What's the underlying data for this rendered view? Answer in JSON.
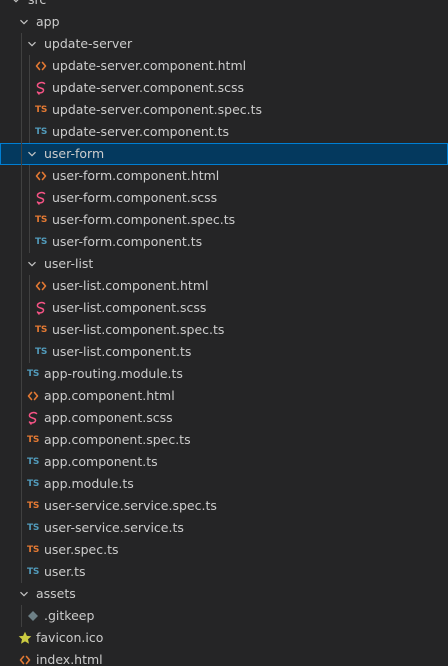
{
  "explorer": {
    "items": [
      {
        "label": "src",
        "kind": "folder",
        "depth": 0,
        "name": "folder-src"
      },
      {
        "label": "app",
        "kind": "folder",
        "depth": 1,
        "name": "folder-app"
      },
      {
        "label": "update-server",
        "kind": "folder",
        "depth": 2,
        "name": "folder-update-server"
      },
      {
        "label": "update-server.component.html",
        "kind": "html",
        "depth": 3,
        "name": "file-update-server-component-html"
      },
      {
        "label": "update-server.component.scss",
        "kind": "scss",
        "depth": 3,
        "name": "file-update-server-component-scss"
      },
      {
        "label": "update-server.component.spec.ts",
        "kind": "spec",
        "depth": 3,
        "name": "file-update-server-component-spec-ts"
      },
      {
        "label": "update-server.component.ts",
        "kind": "ts",
        "depth": 3,
        "name": "file-update-server-component-ts"
      },
      {
        "label": "user-form",
        "kind": "folder",
        "depth": 2,
        "selected": true,
        "name": "folder-user-form"
      },
      {
        "label": "user-form.component.html",
        "kind": "html",
        "depth": 3,
        "name": "file-user-form-component-html"
      },
      {
        "label": "user-form.component.scss",
        "kind": "scss",
        "depth": 3,
        "name": "file-user-form-component-scss"
      },
      {
        "label": "user-form.component.spec.ts",
        "kind": "spec",
        "depth": 3,
        "name": "file-user-form-component-spec-ts"
      },
      {
        "label": "user-form.component.ts",
        "kind": "ts",
        "depth": 3,
        "name": "file-user-form-component-ts"
      },
      {
        "label": "user-list",
        "kind": "folder",
        "depth": 2,
        "name": "folder-user-list"
      },
      {
        "label": "user-list.component.html",
        "kind": "html",
        "depth": 3,
        "name": "file-user-list-component-html"
      },
      {
        "label": "user-list.component.scss",
        "kind": "scss",
        "depth": 3,
        "name": "file-user-list-component-scss"
      },
      {
        "label": "user-list.component.spec.ts",
        "kind": "spec",
        "depth": 3,
        "name": "file-user-list-component-spec-ts"
      },
      {
        "label": "user-list.component.ts",
        "kind": "ts",
        "depth": 3,
        "name": "file-user-list-component-ts"
      },
      {
        "label": "app-routing.module.ts",
        "kind": "ts",
        "depth": 2,
        "name": "file-app-routing-module-ts"
      },
      {
        "label": "app.component.html",
        "kind": "html",
        "depth": 2,
        "name": "file-app-component-html"
      },
      {
        "label": "app.component.scss",
        "kind": "scss",
        "depth": 2,
        "name": "file-app-component-scss"
      },
      {
        "label": "app.component.spec.ts",
        "kind": "spec",
        "depth": 2,
        "name": "file-app-component-spec-ts"
      },
      {
        "label": "app.component.ts",
        "kind": "ts",
        "depth": 2,
        "name": "file-app-component-ts"
      },
      {
        "label": "app.module.ts",
        "kind": "ts",
        "depth": 2,
        "name": "file-app-module-ts"
      },
      {
        "label": "user-service.service.spec.ts",
        "kind": "spec",
        "depth": 2,
        "name": "file-user-service-service-spec-ts"
      },
      {
        "label": "user-service.service.ts",
        "kind": "ts",
        "depth": 2,
        "name": "file-user-service-service-ts"
      },
      {
        "label": "user.spec.ts",
        "kind": "spec",
        "depth": 2,
        "name": "file-user-spec-ts"
      },
      {
        "label": "user.ts",
        "kind": "ts",
        "depth": 2,
        "name": "file-user-ts"
      },
      {
        "label": "assets",
        "kind": "folder",
        "depth": 1,
        "name": "folder-assets"
      },
      {
        "label": ".gitkeep",
        "kind": "gitkeep",
        "depth": 2,
        "name": "file-gitkeep"
      },
      {
        "label": "favicon.ico",
        "kind": "favicon",
        "depth": 1,
        "name": "file-favicon-ico"
      },
      {
        "label": "index.html",
        "kind": "html",
        "depth": 1,
        "name": "file-index-html"
      }
    ]
  },
  "icons": {
    "folder": "chevron-down-icon",
    "html": "html-file-icon",
    "scss": "sass-file-icon",
    "spec": "ts-spec-file-icon",
    "ts": "typescript-file-icon",
    "gitkeep": "git-file-icon",
    "favicon": "star-icon"
  },
  "icon_text": {
    "ts_badge": "TS"
  },
  "colors": {
    "background": "#252526",
    "text": "#cccccc",
    "selected_background": "#04395e",
    "selected_border": "#007fd4",
    "indent_guide": "#404040",
    "html_icon": "#e37933",
    "scss_icon": "#f55385",
    "ts_icon": "#519aba",
    "spec_icon": "#e37933",
    "gitkeep_icon": "#6d8086",
    "favicon_icon": "#cbcb41"
  }
}
